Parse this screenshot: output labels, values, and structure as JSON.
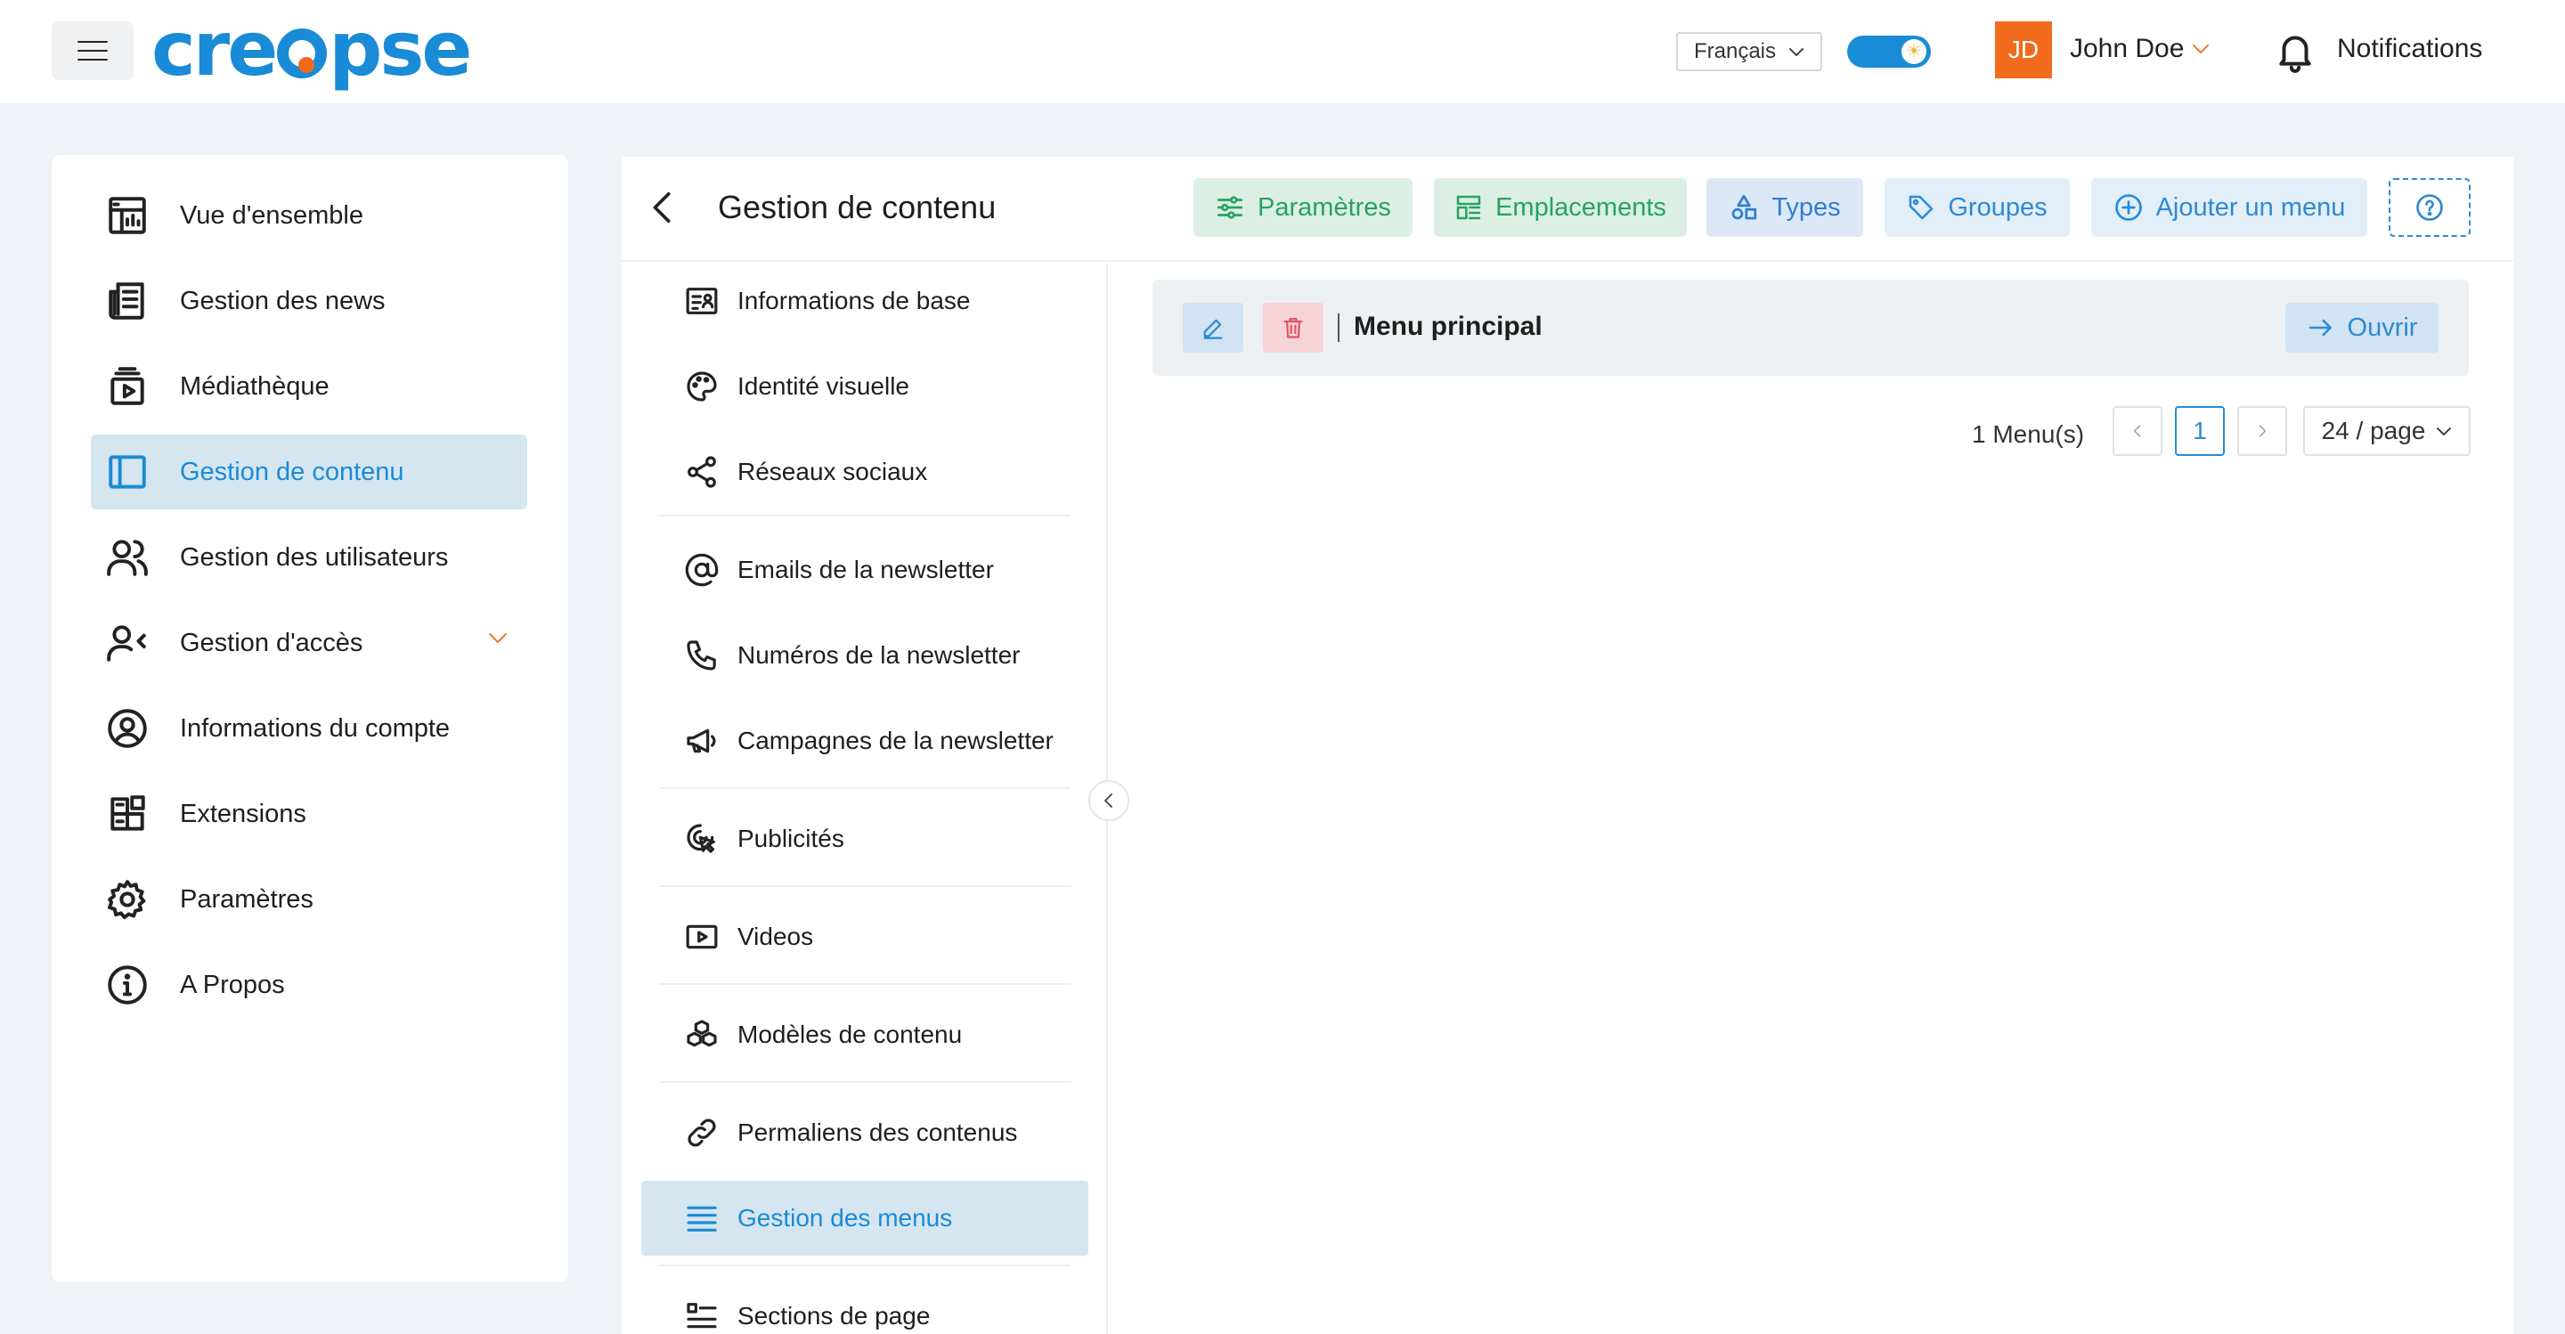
{
  "header": {
    "logo_text": "creopse",
    "language": "Français",
    "avatar_initials": "JD",
    "user_name": "John Doe",
    "notifications_label": "Notifications"
  },
  "sidebar": {
    "items": [
      {
        "label": "Vue d'ensemble",
        "icon": "dashboard-icon"
      },
      {
        "label": "Gestion des news",
        "icon": "newspaper-icon"
      },
      {
        "label": "Médiathèque",
        "icon": "media-library-icon"
      },
      {
        "label": "Gestion de contenu",
        "icon": "layout-icon",
        "active": true
      },
      {
        "label": "Gestion des utilisateurs",
        "icon": "users-icon"
      },
      {
        "label": "Gestion d'accès",
        "icon": "user-access-icon",
        "expandable": true
      },
      {
        "label": "Informations du compte",
        "icon": "user-circle-icon"
      },
      {
        "label": "Extensions",
        "icon": "extensions-icon"
      },
      {
        "label": "Paramètres",
        "icon": "gear-icon"
      },
      {
        "label": "A Propos",
        "icon": "info-icon"
      }
    ]
  },
  "main": {
    "title": "Gestion de contenu",
    "actions": {
      "parametres": "Paramètres",
      "emplacements": "Emplacements",
      "types": "Types",
      "groupes": "Groupes",
      "ajouter": "Ajouter un menu"
    },
    "submenu": [
      {
        "label": "Informations de base",
        "icon": "id-card-icon"
      },
      {
        "label": "Identité visuelle",
        "icon": "palette-icon"
      },
      {
        "label": "Réseaux sociaux",
        "icon": "share-icon"
      },
      {
        "label": "Emails de la newsletter",
        "icon": "at-sign-icon"
      },
      {
        "label": "Numéros de la newsletter",
        "icon": "phone-icon"
      },
      {
        "label": "Campagnes de la newsletter",
        "icon": "megaphone-icon"
      },
      {
        "label": "Publicités",
        "icon": "ad-click-icon"
      },
      {
        "label": "Videos",
        "icon": "video-icon"
      },
      {
        "label": "Modèles de contenu",
        "icon": "cubes-icon"
      },
      {
        "label": "Permaliens des contenus",
        "icon": "link-icon"
      },
      {
        "label": "Gestion des menus",
        "icon": "menu-lines-icon",
        "active": true
      },
      {
        "label": "Sections de page",
        "icon": "sections-icon"
      }
    ],
    "menus": [
      {
        "name": "Menu principal",
        "open_label": "Ouvrir"
      }
    ],
    "pagination": {
      "total": "1 Menu(s)",
      "current_page": "1",
      "per_page": "24 / page"
    }
  },
  "colors": {
    "brand_blue": "#1a8bd6",
    "brand_orange": "#f26b1d",
    "active_bg": "#d5e6f1",
    "green": "#27a35f",
    "red": "#e25463"
  }
}
